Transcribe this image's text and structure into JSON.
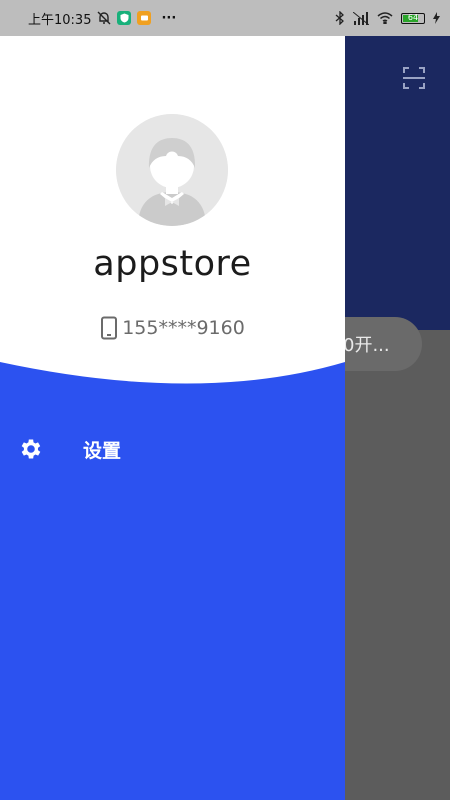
{
  "status_bar": {
    "time": "上午10:35",
    "dots": "···",
    "battery_level": "64",
    "colors": {
      "shield_badge": "#18b07a",
      "message_badge": "#f0a020"
    }
  },
  "user": {
    "name": "appstore",
    "phone": "155****9160"
  },
  "menu": {
    "items": [
      {
        "label": "设置",
        "icon": "gear-icon"
      }
    ]
  },
  "background_app": {
    "search_text": "0开...",
    "icons": [
      "scan-icon"
    ]
  },
  "colors": {
    "drawer_blue": "#2c52f0",
    "header_bg": "#ffffff",
    "background_navy": "#1b2860",
    "scrim_gray": "#5c5c5c"
  }
}
